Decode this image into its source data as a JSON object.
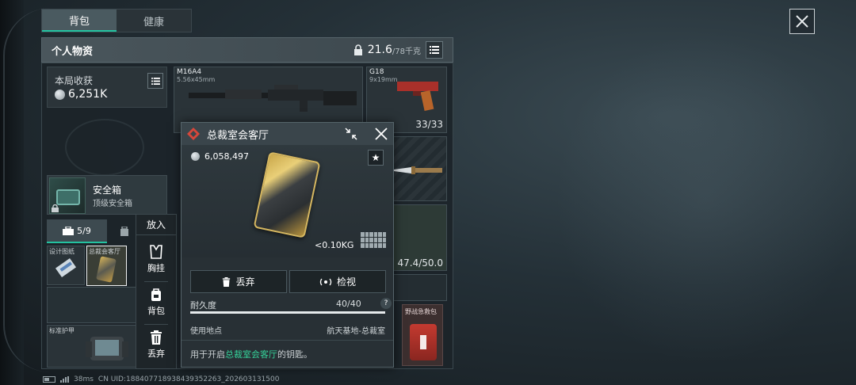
{
  "top_tabs": [
    {
      "label": "背包",
      "active": true
    },
    {
      "label": "健康",
      "active": false
    }
  ],
  "header": {
    "title": "个人物资",
    "weight_current": "21.6",
    "weight_max": "/78千克"
  },
  "haul": {
    "title": "本局收获",
    "value": "6,251K"
  },
  "safe_box": {
    "name": "安全箱",
    "subtitle": "顶级安全箱"
  },
  "sub_tabs": {
    "bag_count": "5/9"
  },
  "slots": {
    "item1_label": "设计图纸",
    "item2_label": "总裁会客厅",
    "armor_label": "标准护甲"
  },
  "weapons": {
    "primary_name": "M16A4",
    "primary_caliber": "5.56x45mm",
    "secondary_name": "G18",
    "secondary_caliber": "9x19mm",
    "secondary_ammo": "33/33",
    "capacity": "47.4/50.0",
    "medkit_label": "野战急救包"
  },
  "context_menu": {
    "header": "放入",
    "items": [
      {
        "label": "胸挂",
        "icon": "chest-rig-icon"
      },
      {
        "label": "背包",
        "icon": "backpack-icon"
      },
      {
        "label": "丢弃",
        "icon": "trash-icon"
      }
    ]
  },
  "popup": {
    "title": "总裁室会客厅",
    "value": "6,058,497",
    "weight": "<0.10KG",
    "discard_label": "丢弃",
    "inspect_label": "检视",
    "durability_label": "耐久度",
    "durability_value": "40/40",
    "durability_fraction": 1.0,
    "use_location_label": "使用地点",
    "use_location_value": "航天基地-总裁室",
    "desc_prefix": "用于开启",
    "desc_highlight": "总裁室会客厅",
    "desc_suffix": "的钥匙。"
  },
  "footer": {
    "ping": "38ms",
    "uid": "CN UID:18840771893843935226​3_202603131500"
  },
  "colors": {
    "accent": "#23c2a0",
    "highlight": "#35d39a",
    "popup_badge": "#d6473b"
  }
}
